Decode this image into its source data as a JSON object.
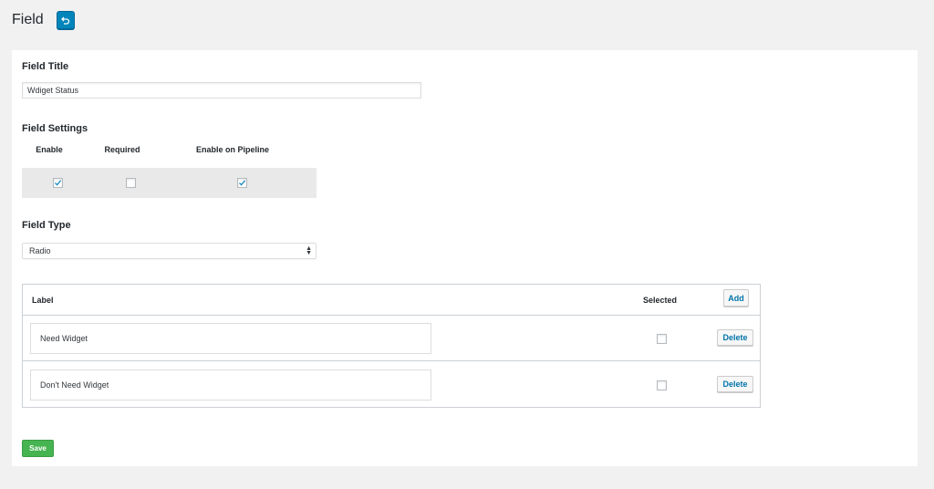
{
  "page": {
    "title": "Field",
    "back_icon": "undo-icon",
    "accent_color": "#0085ba"
  },
  "form": {
    "title_label": "Field Title",
    "title_value": "Wdiget Status",
    "settings_label": "Field Settings",
    "settings": [
      {
        "label": "Enable",
        "checked": true
      },
      {
        "label": "Required",
        "checked": false
      },
      {
        "label": "Enable on Pipeline",
        "checked": true
      }
    ],
    "type_label": "Field Type",
    "type_value": "Radio"
  },
  "options_table": {
    "col_label": "Label",
    "col_selected": "Selected",
    "add_label": "Add",
    "rows": [
      {
        "label": "Need Widget",
        "selected": false,
        "delete_label": "Delete"
      },
      {
        "label": "Don't Need Widget",
        "selected": false,
        "delete_label": "Delete"
      }
    ]
  },
  "save_label": "Save",
  "save_color": "#46b450"
}
